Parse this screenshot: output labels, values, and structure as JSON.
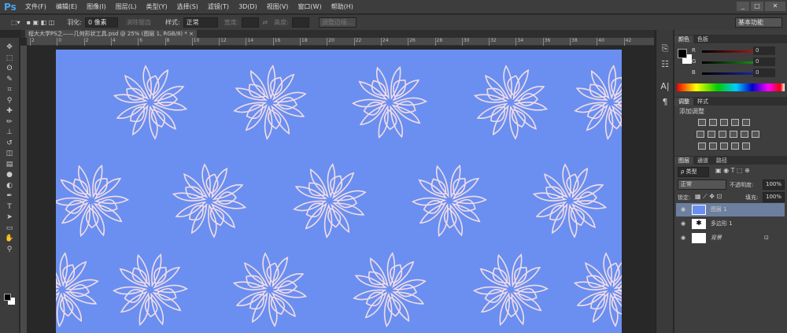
{
  "app": {
    "logo": "Ps",
    "menus": [
      "文件(F)",
      "编辑(E)",
      "图像(I)",
      "图层(L)",
      "类型(Y)",
      "选择(S)",
      "滤镜(T)",
      "3D(D)",
      "视图(V)",
      "窗口(W)",
      "帮助(H)"
    ],
    "window_controls": [
      "_",
      "□",
      "✕"
    ]
  },
  "options": {
    "feather_label": "羽化:",
    "feather_value": "0 像素",
    "antialias": "消除锯齿",
    "style_label": "样式:",
    "style_value": "正常",
    "width_label": "宽度:",
    "height_label": "高度:",
    "refine_edge": "调整边缘...",
    "workspace": "基本功能"
  },
  "document": {
    "tab_title": "程大大学PS之——几何形状工具.psd @ 25% (图层 1, RGB/8) *",
    "close": "×",
    "canvas_color": "#6a8ff0",
    "ruler_labels": [
      "2",
      "0",
      "2",
      "4",
      "6",
      "8",
      "10",
      "12",
      "14",
      "16",
      "18",
      "20",
      "22",
      "24",
      "26",
      "28",
      "30",
      "32",
      "34",
      "36",
      "38",
      "40",
      "42"
    ]
  },
  "color_panel": {
    "tabs": [
      "颜色",
      "色板"
    ],
    "channels": [
      {
        "name": "R",
        "value": "0",
        "color": "#e02020"
      },
      {
        "name": "G",
        "value": "0",
        "color": "#20c020"
      },
      {
        "name": "B",
        "value": "0",
        "color": "#2030e0"
      }
    ]
  },
  "adjust_panel": {
    "tabs": [
      "调整",
      "样式"
    ],
    "title": "添加调整"
  },
  "layers_panel": {
    "tabs": [
      "图层",
      "通道",
      "路径"
    ],
    "filter": "ρ 类型",
    "blend": "正常",
    "opacity_label": "不透明度:",
    "opacity": "100%",
    "lock_label": "锁定:",
    "fill_label": "填充:",
    "fill": "100%",
    "layers": [
      {
        "name": "图层 1",
        "selected": true
      },
      {
        "name": "多边形 1",
        "selected": false
      },
      {
        "name": "背景",
        "selected": false,
        "locked": true
      }
    ]
  }
}
